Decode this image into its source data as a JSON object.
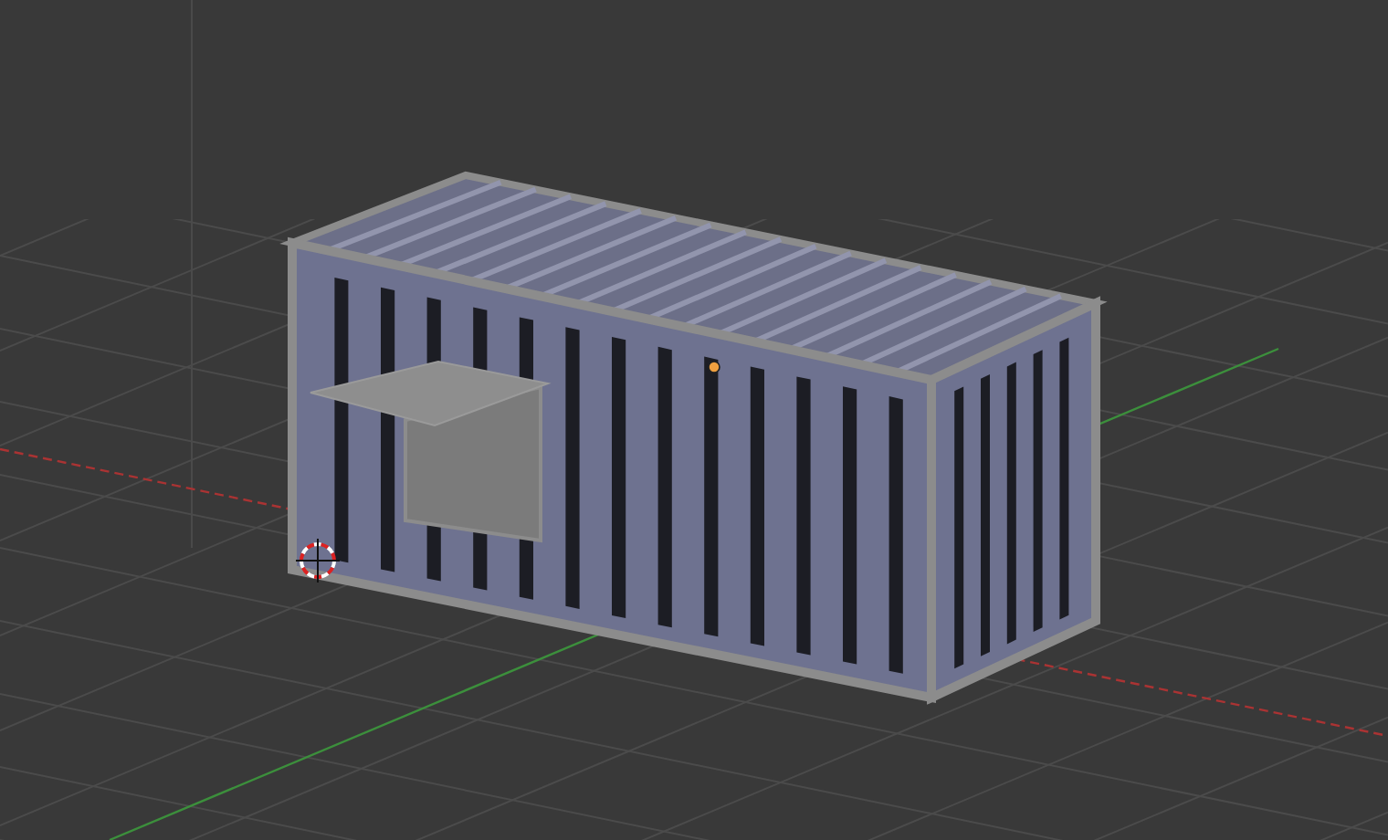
{
  "viewport": {
    "grid": true,
    "axes": true,
    "cursor": true,
    "origin": true
  }
}
